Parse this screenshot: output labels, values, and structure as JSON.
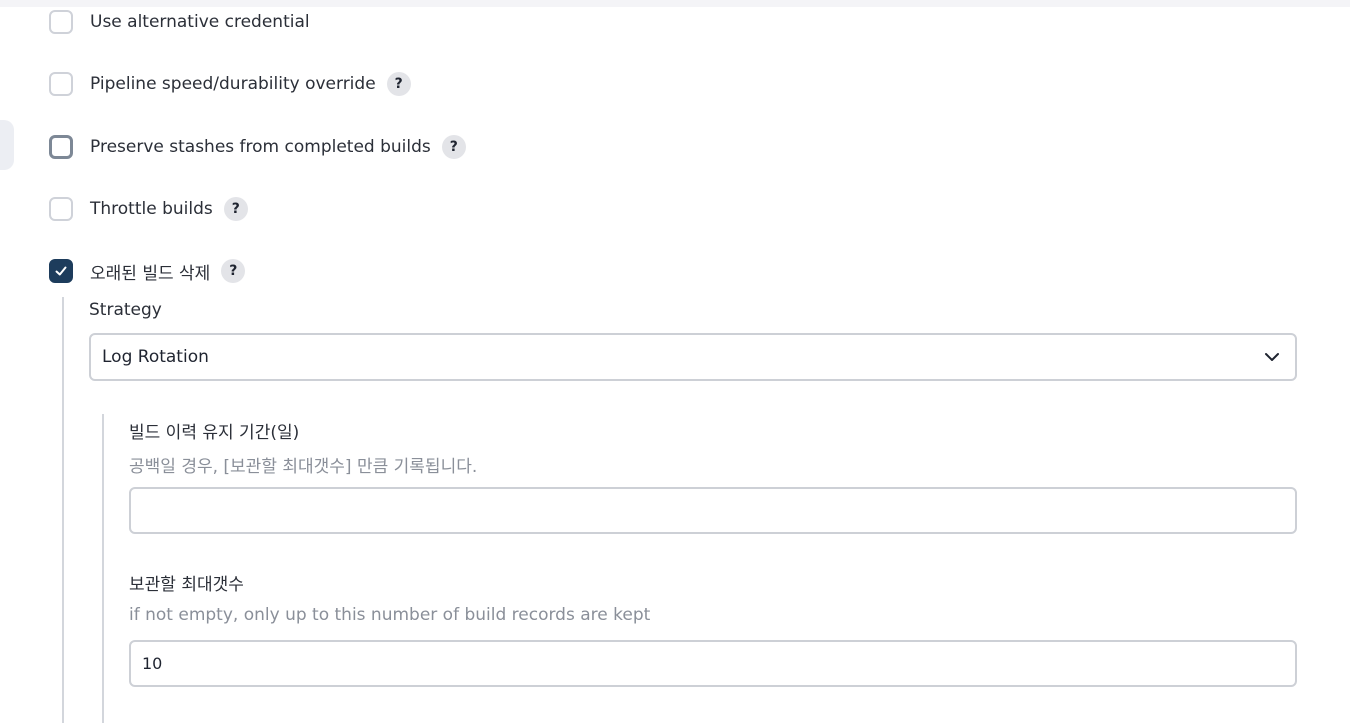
{
  "options": [
    {
      "label": "Use alternative credential",
      "checked": false,
      "help": false
    },
    {
      "label": "Pipeline speed/durability override",
      "checked": false,
      "help": true
    },
    {
      "label": "Preserve stashes from completed builds",
      "checked": false,
      "help": true
    },
    {
      "label": "Throttle builds",
      "checked": false,
      "help": true
    },
    {
      "label": "오래된 빌드 삭제",
      "checked": true,
      "help": true
    }
  ],
  "help_glyph": "?",
  "strategy": {
    "label": "Strategy",
    "selected": "Log Rotation"
  },
  "days_to_keep": {
    "label": "빌드 이력 유지 기간(일)",
    "description": "공백일 경우, [보관할 최대갯수] 만큼 기록됩니다.",
    "value": ""
  },
  "max_to_keep": {
    "label": "보관할 최대갯수",
    "description": "if not empty, only up to this number of build records are kept",
    "value": "10"
  },
  "colors": {
    "checkbox_checked": "#1d3c5c",
    "checkbox_border": "#cfd2d9",
    "description_text": "#8a8f99"
  }
}
